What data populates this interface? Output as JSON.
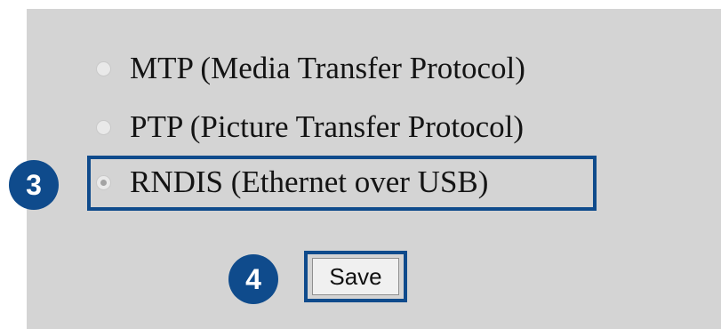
{
  "options": [
    {
      "label": "MTP (Media Transfer Protocol)",
      "selected": false
    },
    {
      "label": "PTP (Picture Transfer Protocol)",
      "selected": false
    },
    {
      "label": "RNDIS (Ethernet over USB)",
      "selected": true
    }
  ],
  "steps": {
    "select_step": "3",
    "save_step": "4"
  },
  "save_label": "Save",
  "colors": {
    "panel_background": "#d4d4d4",
    "annotation_blue": "#0f4b8c"
  }
}
